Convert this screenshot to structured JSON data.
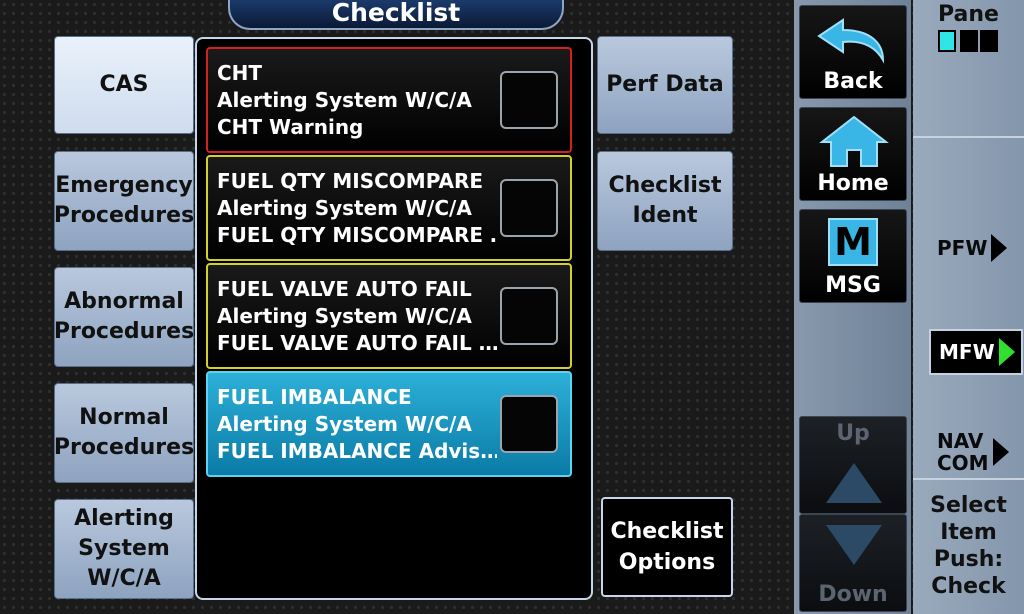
{
  "title": "Checklist",
  "categories": [
    {
      "lines": [
        "CAS"
      ],
      "selected": true
    },
    {
      "lines": [
        "Emergency",
        "Procedures"
      ]
    },
    {
      "lines": [
        "Abnormal",
        "Procedures"
      ]
    },
    {
      "lines": [
        "Normal",
        "Procedures"
      ]
    },
    {
      "lines": [
        "Alerting",
        "System",
        "W/C/A"
      ]
    }
  ],
  "right_buttons": {
    "perf_data": "Perf Data",
    "checklist_ident": [
      "Checklist",
      "Ident"
    ],
    "checklist_options": [
      "Checklist",
      "Options"
    ]
  },
  "checklist_items": [
    {
      "line1": "CHT",
      "line2": "Alerting System W/C/A",
      "line3": "CHT Warning",
      "level": "warning"
    },
    {
      "line1": "FUEL QTY MISCOMPARE",
      "line2": "Alerting System W/C/A",
      "line3": "FUEL QTY MISCOMPARE …",
      "level": "caution"
    },
    {
      "line1": "FUEL VALVE AUTO FAIL",
      "line2": "Alerting System W/C/A",
      "line3": "FUEL VALVE AUTO FAIL …",
      "level": "caution"
    },
    {
      "line1": "FUEL IMBALANCE",
      "line2": "Alerting System W/C/A",
      "line3": "FUEL IMBALANCE Advis…",
      "level": "advisory",
      "selected": true
    }
  ],
  "sidebar": {
    "back": "Back",
    "home": "Home",
    "msg": "MSG",
    "msg_icon_letter": "M",
    "up": "Up",
    "down": "Down"
  },
  "right_panel": {
    "pane_label": "Pane",
    "softkeys": {
      "pfw": "PFW",
      "mfw": "MFW",
      "navcom_1": "NAV",
      "navcom_2": "COM"
    },
    "hint": [
      "Select",
      "Item",
      "Push:",
      "Check"
    ]
  },
  "colors": {
    "warning": "#d42020",
    "caution": "#d4d02a",
    "selected": "#1ea3cf",
    "active_arrow": "#2fe02f"
  }
}
